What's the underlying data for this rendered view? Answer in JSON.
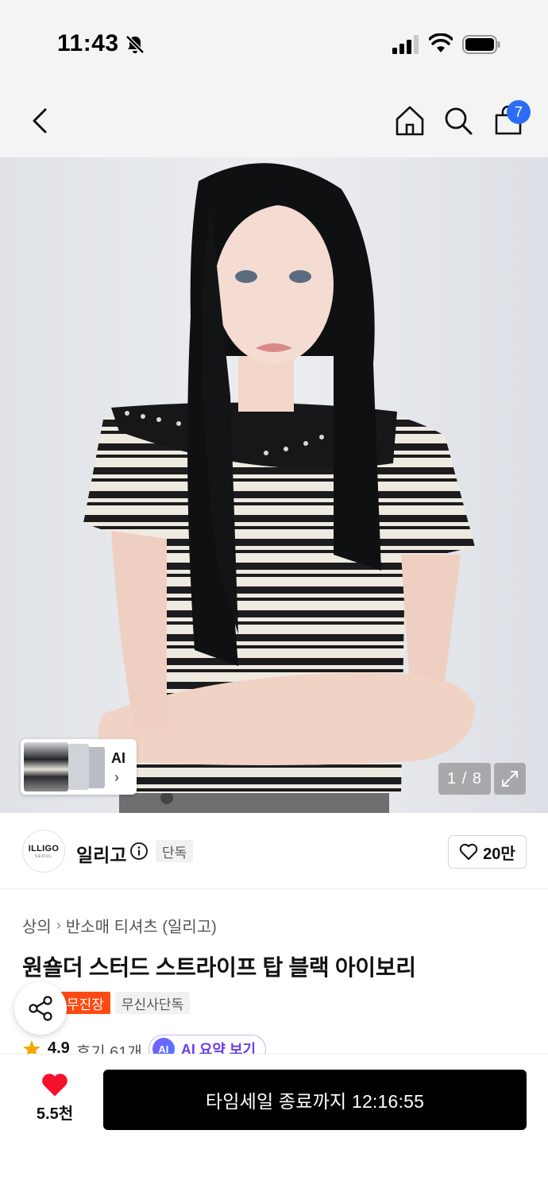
{
  "status_bar": {
    "time": "11:43"
  },
  "header": {
    "cart_count": "7"
  },
  "gallery": {
    "ai_label": "AI",
    "chevron": "›",
    "page_counter": "1 / 8"
  },
  "brand": {
    "logo_text": "ILLIGO",
    "logo_sub": "SEOUL",
    "name": "일리고",
    "exclusive_tag": "단독",
    "like_count": "20만"
  },
  "product": {
    "breadcrumb": [
      "상의",
      "반소매 티셔츠 (일리고)"
    ],
    "breadcrumb_sep": "›",
    "title": "원숄더 스터드 스트라이프 탑 블랙 아이보리",
    "badges": [
      "무진장",
      "무신사단독"
    ],
    "rating": "4.9",
    "reviews": "후기 61개",
    "ai_summary_icon": "AI",
    "ai_summary_label": "AI 요약 보기"
  },
  "bottom_bar": {
    "wish_count": "5.5천",
    "cta_label": "타임세일 종료까지 12:16:55"
  },
  "colors": {
    "accent_blue": "#2b6df6",
    "badge_red": "#ff4a12",
    "heart_red": "#f5102c",
    "cta_black": "#000000"
  },
  "icons": [
    "bell-off-icon",
    "signal-icon",
    "wifi-icon",
    "battery-icon",
    "back-icon",
    "home-icon",
    "search-icon",
    "cart-icon",
    "expand-icon",
    "info-icon",
    "heart-outline-icon",
    "share-icon",
    "star-icon",
    "heart-filled-icon"
  ]
}
